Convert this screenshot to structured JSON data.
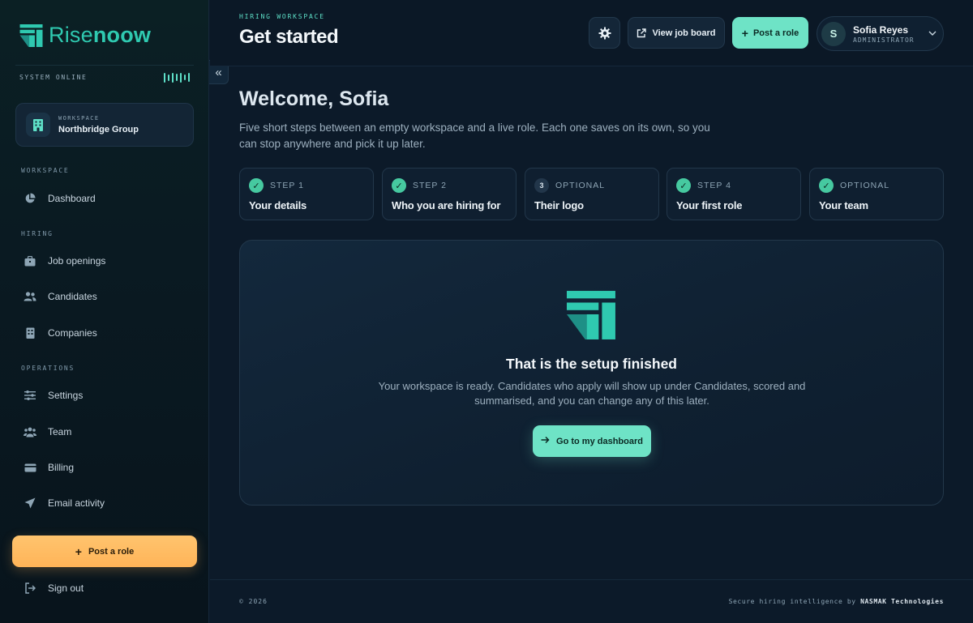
{
  "brand": {
    "name_light": "Rise",
    "name_bold": "noow",
    "accent": "#2fc9b0",
    "cta_orange": "#ffb458",
    "cta_teal": "#6ee3c6"
  },
  "sidebar": {
    "system_status": "SYSTEM ONLINE",
    "workspace_label": "WORKSPACE",
    "workspace_name": "Northbridge Group",
    "sections": {
      "workspace": "WORKSPACE",
      "hiring": "HIRING",
      "operations": "OPERATIONS"
    },
    "items": {
      "dashboard": "Dashboard",
      "job_openings": "Job openings",
      "candidates": "Candidates",
      "companies": "Companies",
      "settings": "Settings",
      "team": "Team",
      "billing": "Billing",
      "email_activity": "Email activity"
    },
    "post_role": "Post a role",
    "sign_out": "Sign out"
  },
  "header": {
    "eyebrow": "HIRING WORKSPACE",
    "title": "Get started",
    "view_job_board": "View job board",
    "post_role": "Post a role",
    "user_name": "Sofia Reyes",
    "user_role": "ADMINISTRATOR",
    "avatar_initial": "S"
  },
  "main": {
    "welcome": "Welcome, Sofia",
    "intro": "Five short steps between an empty workspace and a live role. Each one saves on its own, so you can stop anywhere and pick it up later.",
    "steps": [
      {
        "label": "STEP 1",
        "title": "Your details",
        "done": true
      },
      {
        "label": "STEP 2",
        "title": "Who you are hiring for",
        "done": true
      },
      {
        "label": "OPTIONAL",
        "title": "Their logo",
        "done": false,
        "number": "3"
      },
      {
        "label": "STEP 4",
        "title": "Your first role",
        "done": true
      },
      {
        "label": "OPTIONAL",
        "title": "Your team",
        "done": true
      }
    ],
    "done_title": "That is the setup finished",
    "done_text": "Your workspace is ready. Candidates who apply will show up under Candidates, scored and summarised, and you can change any of this later.",
    "dashboard_button": "Go to my dashboard"
  },
  "footer": {
    "copyright": "© 2026",
    "powered_prefix": "Secure hiring intelligence by",
    "powered_company": "NASMAK Technologies"
  }
}
